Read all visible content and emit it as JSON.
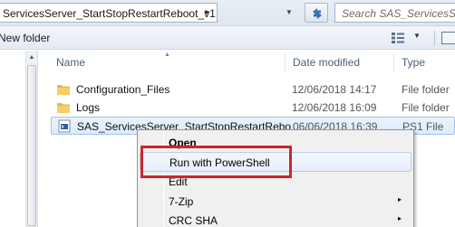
{
  "address": {
    "path_text": "ServicesServer_StartStopRestartReboot_v1",
    "chevron": "▸",
    "dropdown": "▼"
  },
  "search": {
    "placeholder": "Search SAS_ServicesServ"
  },
  "toolbar": {
    "new_folder_label": "New folder",
    "view_dropdown": "▼"
  },
  "columns": {
    "name": "Name",
    "date_modified": "Date modified",
    "type": "Type"
  },
  "files": [
    {
      "name": "Configuration_Files",
      "date": "12/06/2018 14:17",
      "type": "File folder",
      "icon": "folder-icon"
    },
    {
      "name": "Logs",
      "date": "12/06/2018 16:09",
      "type": "File folder",
      "icon": "folder-icon"
    },
    {
      "name": "SAS_ServicesServer_StartStopRestartRebo",
      "date": "06/06/2018 16:39",
      "type": "PS1 File",
      "icon": "ps1-file-icon"
    }
  ],
  "context_menu": {
    "items": [
      {
        "label": "Open",
        "bold": true
      },
      {
        "label": "Run with PowerShell",
        "bold": false
      },
      {
        "label": "Edit",
        "bold": false
      },
      {
        "label": "7-Zip",
        "bold": false,
        "submenu": "▸"
      },
      {
        "label": "CRC SHA",
        "bold": false,
        "submenu": "▸"
      }
    ]
  },
  "colors": {
    "highlight_box": "#c8282d",
    "selection": "#dcebfc",
    "header_text": "#4c607a"
  }
}
